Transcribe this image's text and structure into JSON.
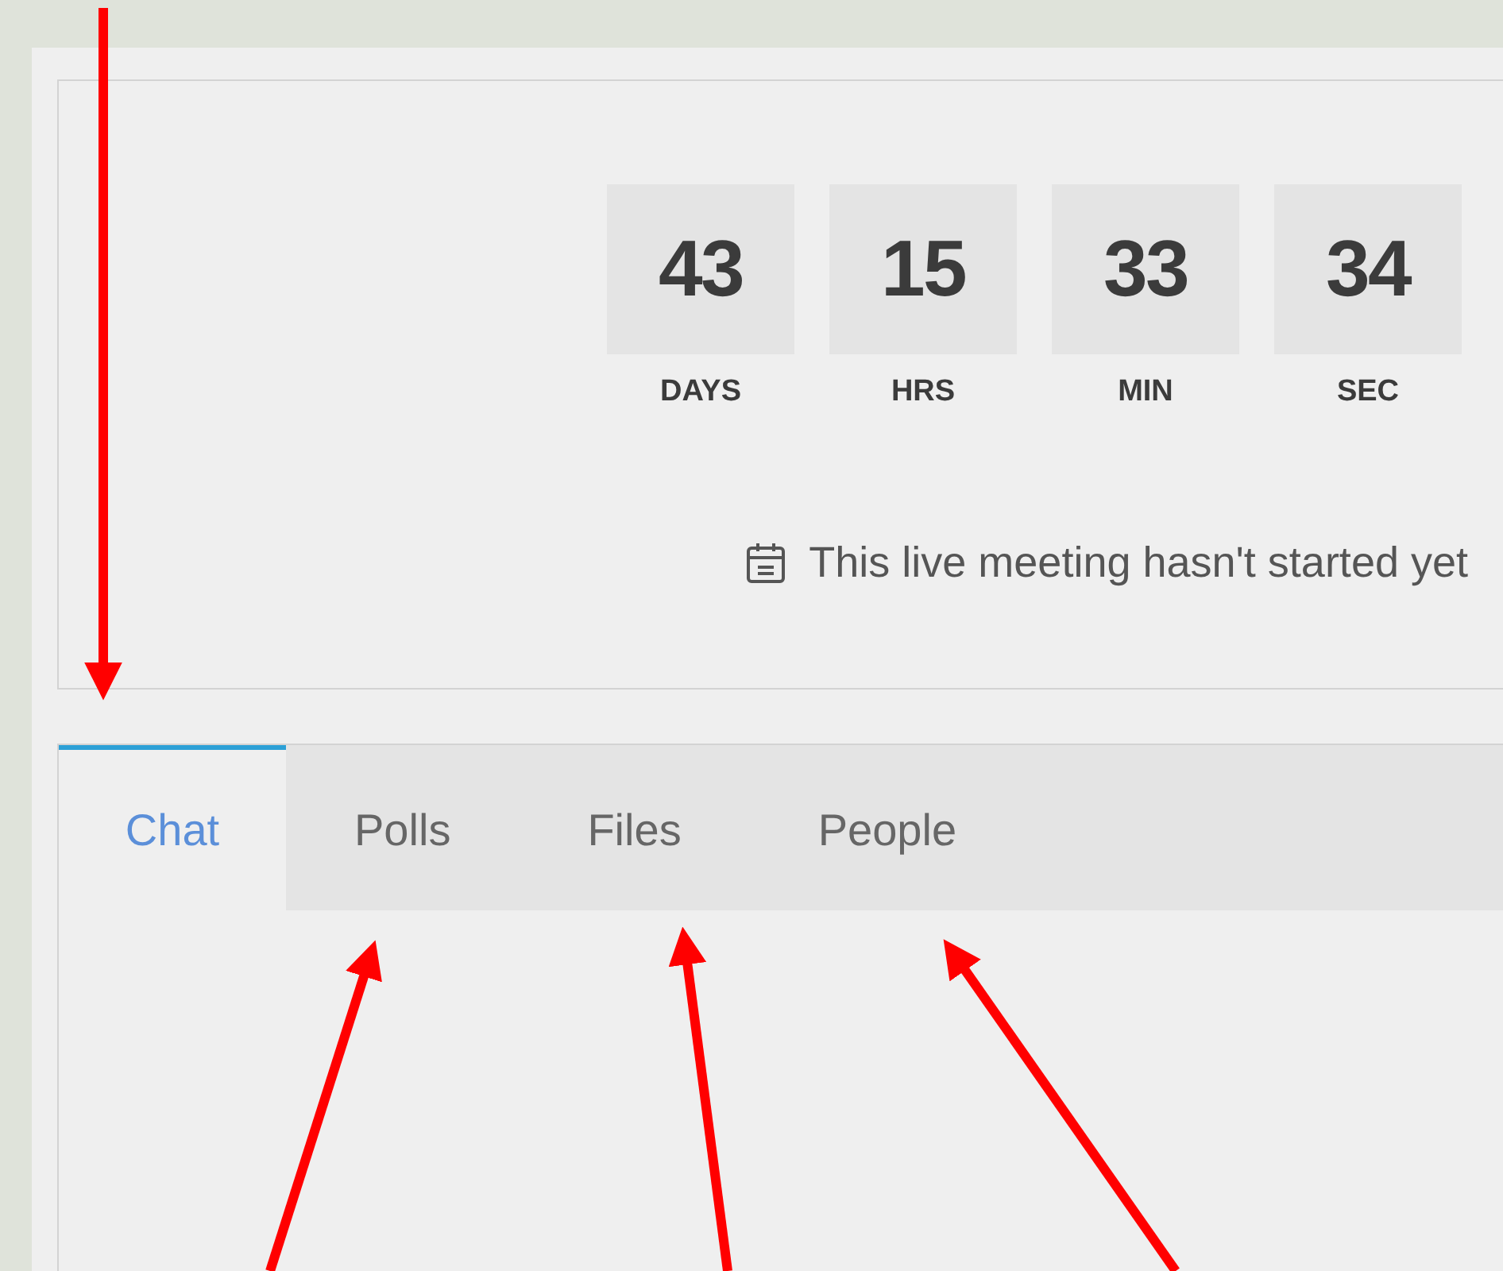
{
  "countdown": {
    "units": [
      {
        "value": "43",
        "label": "DAYS"
      },
      {
        "value": "15",
        "label": "HRS"
      },
      {
        "value": "33",
        "label": "MIN"
      },
      {
        "value": "34",
        "label": "SEC"
      }
    ],
    "message": "This live meeting hasn't started yet"
  },
  "tabs": [
    {
      "label": "Chat",
      "selected": true
    },
    {
      "label": "Polls",
      "selected": false
    },
    {
      "label": "Files",
      "selected": false
    },
    {
      "label": "People",
      "selected": false
    }
  ]
}
